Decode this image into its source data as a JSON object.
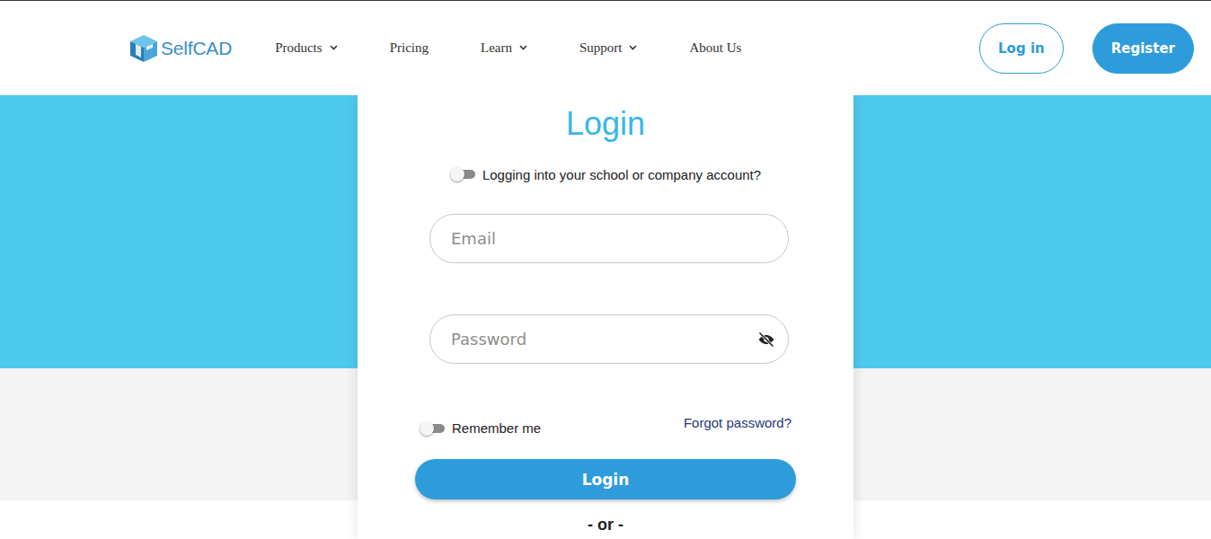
{
  "brand": {
    "name": "SelfCAD"
  },
  "nav": [
    {
      "label": "Products",
      "has_dropdown": true
    },
    {
      "label": "Pricing",
      "has_dropdown": false
    },
    {
      "label": "Learn",
      "has_dropdown": true
    },
    {
      "label": "Support",
      "has_dropdown": true
    },
    {
      "label": "About Us",
      "has_dropdown": false
    }
  ],
  "header_buttons": [
    {
      "label": "Log in",
      "kind": "outline"
    },
    {
      "label": "Register",
      "kind": "filled"
    }
  ],
  "login": {
    "title": "Login",
    "org_toggle": {
      "label": "Logging into your school or company account?",
      "on": false
    },
    "fields": [
      {
        "placeholder": "Email",
        "kind": "text"
      },
      {
        "placeholder": "Password",
        "kind": "password"
      }
    ],
    "remember": {
      "label": "Remember me",
      "on": false
    },
    "forgot": "Forgot password?",
    "submit": "Login",
    "divider": "- or -"
  }
}
